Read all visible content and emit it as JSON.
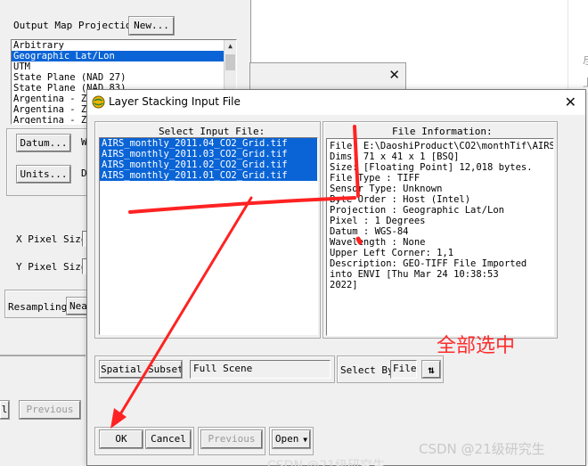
{
  "background_page": {
    "glyphs": [
      "尽",
      "上"
    ]
  },
  "projection_panel": {
    "title": "Output Map Projection",
    "new_button": "New...",
    "projections": [
      "Arbitrary",
      "Geographic Lat/Lon",
      "UTM",
      "State Plane (NAD 27)",
      "State Plane (NAD 83)",
      "Argentina - Zo",
      "Argentina - Zo",
      "Argentina - Zo"
    ],
    "selected_index": 1,
    "datum_button": "Datum...",
    "datum_trunc": "W",
    "units_button": "Units...",
    "units_trunc": "D",
    "x_pixel_label": "X Pixel Size",
    "y_pixel_label": "Y Pixel Size",
    "resampling_label": "Resampling",
    "resampling_value": "Nea",
    "previous_button": "Previous",
    "left_btn_trunc": "l"
  },
  "main_dialog": {
    "title": "Layer Stacking Input File",
    "select_label": "Select Input File:",
    "files": [
      "AIRS_monthly_2011.04_CO2_Grid.tif",
      "AIRS_monthly_2011.03_CO2_Grid.tif",
      "AIRS_monthly_2011.02_CO2_Grid.tif",
      "AIRS_monthly_2011.01_CO2_Grid.tif"
    ],
    "info_label": "File Information:",
    "info_lines": [
      "File: E:\\DaoshiProduct\\CO2\\monthTif\\AIRS_",
      "Dims: 71 x 41 x 1 [BSQ]",
      "Size: [Floating Point] 12,018 bytes.",
      "File Type  : TIFF",
      "Sensor Type: Unknown",
      "Byte Order : Host (Intel)",
      "Projection : Geographic Lat/Lon",
      "  Pixel    : 1 Degrees",
      "  Datum    : WGS-84",
      "Wavelength : None",
      "Upper Left Corner: 1,1",
      "Description: GEO-TIFF File Imported",
      "into ENVI [Thu Mar 24 10:38:53",
      "2022]"
    ],
    "spatial_subset_button": "Spatial Subset",
    "subset_value": "Full Scene",
    "select_by_label": "Select By",
    "select_by_value": "File",
    "sort_icon": "sort-arrows-icon",
    "ok_button": "OK",
    "cancel_button": "Cancel",
    "previous_button": "Previous",
    "open_button": "Open"
  },
  "annotation_text": "全部选中",
  "watermark": "CSDN @21级研究生",
  "watermark_faint": "CSDN @21级研究生",
  "colors": {
    "selection": "#0a64d6",
    "annotation": "#ff2d2d"
  }
}
